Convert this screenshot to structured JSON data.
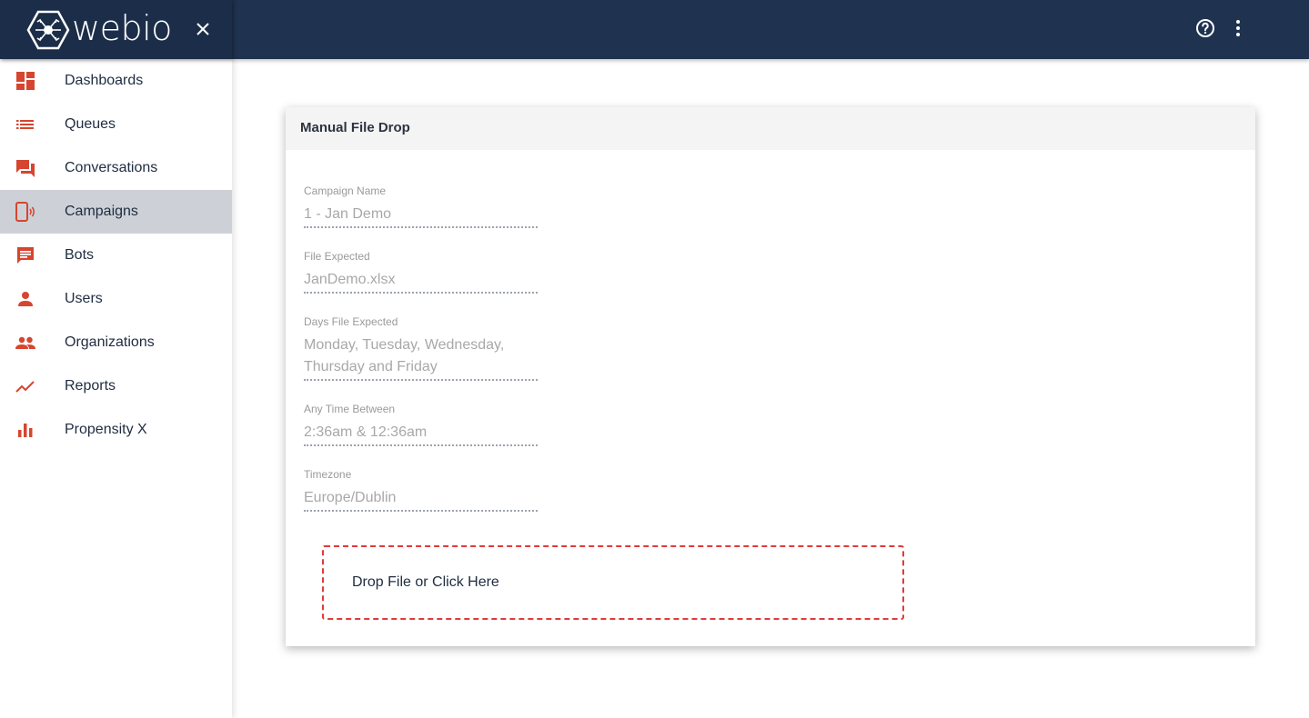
{
  "app": {
    "brand": "webio",
    "colors": {
      "topbar": "#1f3250",
      "accent": "#d6452f",
      "active_row": "#cdd1d7",
      "dropzone_border": "#e13a3a"
    }
  },
  "header": {
    "close_icon": "close-icon",
    "help_icon": "help-circle-icon",
    "more_icon": "more-vertical-icon"
  },
  "sidebar": {
    "items": [
      {
        "label": "Dashboards",
        "icon": "dashboard-icon"
      },
      {
        "label": "Queues",
        "icon": "list-icon"
      },
      {
        "label": "Conversations",
        "icon": "forum-icon"
      },
      {
        "label": "Campaigns",
        "icon": "phone-broadcast-icon",
        "active": true
      },
      {
        "label": "Bots",
        "icon": "chat-message-icon"
      },
      {
        "label": "Users",
        "icon": "person-icon"
      },
      {
        "label": "Organizations",
        "icon": "people-icon"
      },
      {
        "label": "Reports",
        "icon": "trending-line-icon"
      },
      {
        "label": "Propensity X",
        "icon": "bar-chart-icon"
      }
    ]
  },
  "card": {
    "title": "Manual File Drop",
    "fields": [
      {
        "label": "Campaign Name",
        "value": "1 - Jan Demo"
      },
      {
        "label": "File Expected",
        "value": "JanDemo.xlsx"
      },
      {
        "label": "Days File Expected",
        "value": "Monday, Tuesday, Wednesday, Thursday and Friday"
      },
      {
        "label": "Any Time Between",
        "value": "2:36am & 12:36am"
      },
      {
        "label": "Timezone",
        "value": "Europe/Dublin"
      }
    ],
    "dropzone_label": "Drop File or Click Here"
  }
}
